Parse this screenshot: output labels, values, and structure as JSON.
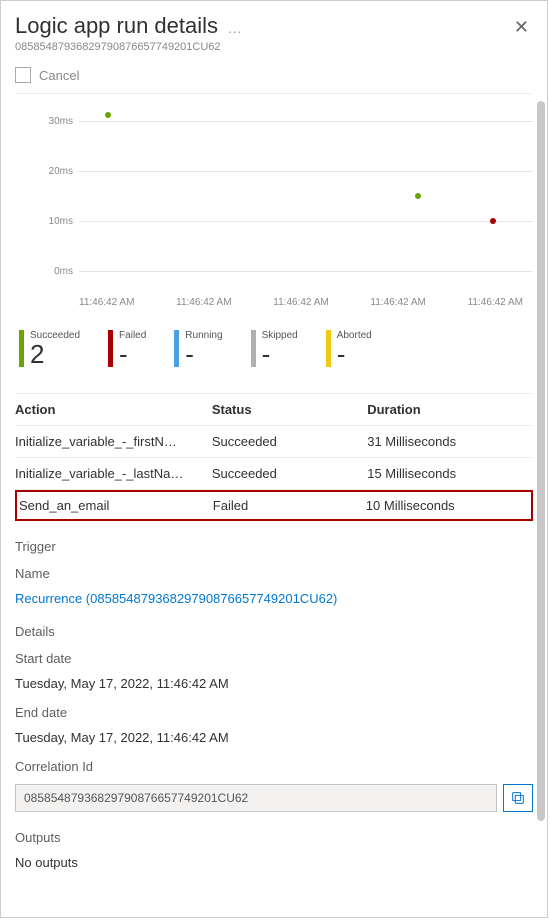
{
  "header": {
    "title": "Logic app run details",
    "run_id": "08585487936829790876657749201CU62"
  },
  "toolbar": {
    "cancel_label": "Cancel"
  },
  "chart_data": {
    "type": "scatter",
    "xlabel": "",
    "ylabel": "",
    "ylim": [
      0,
      30
    ],
    "y_ticks": [
      "30ms",
      "20ms",
      "10ms",
      "0ms"
    ],
    "x_ticks": [
      "11:46:42 AM",
      "11:46:42 AM",
      "11:46:42 AM",
      "11:46:42 AM",
      "11:46:42 AM"
    ],
    "series": [
      {
        "name": "Succeeded",
        "color": "#6ea204",
        "points": [
          {
            "x_index": 0,
            "y": 31
          },
          {
            "x_index": 3,
            "y": 15
          }
        ]
      },
      {
        "name": "Failed",
        "color": "#a80000",
        "points": [
          {
            "x_index": 4,
            "y": 10
          }
        ]
      }
    ]
  },
  "summary": [
    {
      "key": "succeeded",
      "label": "Succeeded",
      "value": "2"
    },
    {
      "key": "failed",
      "label": "Failed",
      "value": "-"
    },
    {
      "key": "running",
      "label": "Running",
      "value": "-"
    },
    {
      "key": "skipped",
      "label": "Skipped",
      "value": "-"
    },
    {
      "key": "aborted",
      "label": "Aborted",
      "value": "-"
    }
  ],
  "table": {
    "headers": {
      "action": "Action",
      "status": "Status",
      "duration": "Duration"
    },
    "rows": [
      {
        "action": "Initialize_variable_-_firstN…",
        "status": "Succeeded",
        "duration": "31 Milliseconds",
        "highlighted": false
      },
      {
        "action": "Initialize_variable_-_lastNa…",
        "status": "Succeeded",
        "duration": "15 Milliseconds",
        "highlighted": false
      },
      {
        "action": "Send_an_email",
        "status": "Failed",
        "duration": "10 Milliseconds",
        "highlighted": true
      }
    ]
  },
  "trigger": {
    "section_label": "Trigger",
    "name_label": "Name",
    "name_value": "Recurrence (08585487936829790876657749201CU62)"
  },
  "details": {
    "section_label": "Details",
    "start_label": "Start date",
    "start_value": "Tuesday, May 17, 2022, 11:46:42 AM",
    "end_label": "End date",
    "end_value": "Tuesday, May 17, 2022, 11:46:42 AM",
    "correlation_label": "Correlation Id",
    "correlation_value": "08585487936829790876657749201CU62"
  },
  "outputs": {
    "section_label": "Outputs",
    "value": "No outputs"
  }
}
